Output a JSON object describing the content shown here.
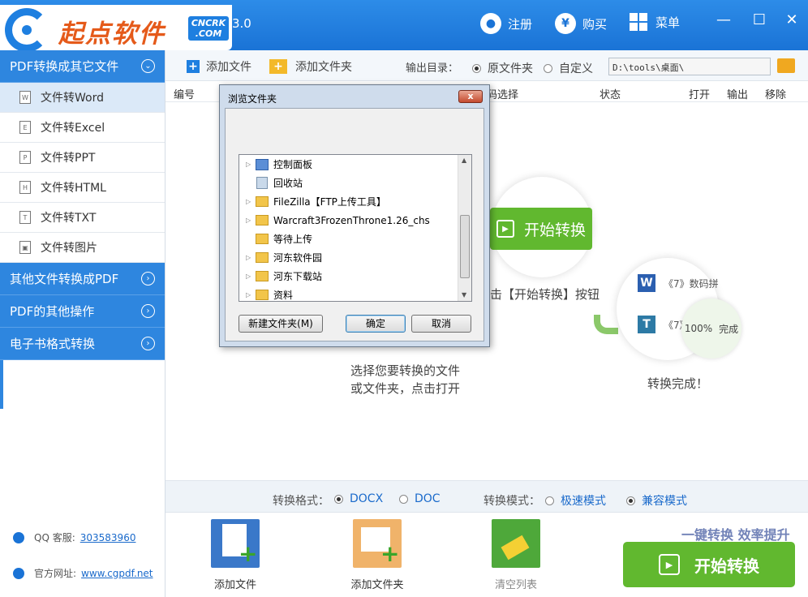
{
  "app": {
    "logo_text": "起点软件",
    "logo_badge_1": "CNCRK",
    "logo_badge_2": ".COM",
    "version": "3.0",
    "register": "注册",
    "buy": "购买",
    "menu": "菜单"
  },
  "sidebar": {
    "sections": [
      {
        "label": "PDF转换成其它文件"
      },
      {
        "label": "其他文件转换成PDF"
      },
      {
        "label": "PDF的其他操作"
      },
      {
        "label": "电子书格式转换"
      }
    ],
    "items": [
      {
        "label": "文件转Word",
        "icon": "W"
      },
      {
        "label": "文件转Excel",
        "icon": "E"
      },
      {
        "label": "文件转PPT",
        "icon": "P"
      },
      {
        "label": "文件转HTML",
        "icon": "H"
      },
      {
        "label": "文件转TXT",
        "icon": "T"
      },
      {
        "label": "文件转图片",
        "icon": "img"
      }
    ],
    "qq_label": "QQ 客服:",
    "qq_value": "303583960",
    "site_label": "官方网址:",
    "site_value": "www.cgpdf.net"
  },
  "toolbar": {
    "add_file": "添加文件",
    "add_folder": "添加文件夹",
    "output_label": "输出目录：",
    "opt_original": "原文件夹",
    "opt_custom": "自定义",
    "path": "D:\\tools\\桌面\\"
  },
  "table": {
    "col_no": "编号",
    "col_select": "码选择",
    "col_status": "状态",
    "col_open": "打开",
    "col_output": "输出",
    "col_remove": "移除"
  },
  "illustration": {
    "start_label": "开始转换",
    "hint_click": "击【开始转换】按钮",
    "hint_select_1": "选择您要转换的文件",
    "hint_select_2": "或文件夹，点击打开",
    "item_1": "《7》数码拼",
    "item_2": "《7》",
    "pct": "100%",
    "done_small": "完成",
    "done": "转换完成！"
  },
  "options": {
    "format_label": "转换格式：",
    "docx": "DOCX",
    "doc": "DOC",
    "mode_label": "转换模式：",
    "fast": "极速模式",
    "compat": "兼容模式"
  },
  "actions": {
    "add_file": "添加文件",
    "add_folder": "添加文件夹",
    "clear": "清空列表",
    "slogan": "一键转换  效率提升",
    "start": "开始转换"
  },
  "dialog": {
    "title": "浏览文件夹",
    "close": "x",
    "tree": [
      {
        "label": "控制面板",
        "type": "cp",
        "expand": true
      },
      {
        "label": "回收站",
        "type": "rb",
        "expand": false
      },
      {
        "label": "FileZilla【FTP上传工具】",
        "type": "fd",
        "expand": true
      },
      {
        "label": "Warcraft3FrozenThrone1.26_chs",
        "type": "fd",
        "expand": true
      },
      {
        "label": "等待上传",
        "type": "fd",
        "expand": false
      },
      {
        "label": "河东软件园",
        "type": "fd",
        "expand": true
      },
      {
        "label": "河东下载站",
        "type": "fd",
        "expand": true
      },
      {
        "label": "资料",
        "type": "fd",
        "expand": true
      }
    ],
    "new_folder": "新建文件夹(M)",
    "ok": "确定",
    "cancel": "取消"
  }
}
